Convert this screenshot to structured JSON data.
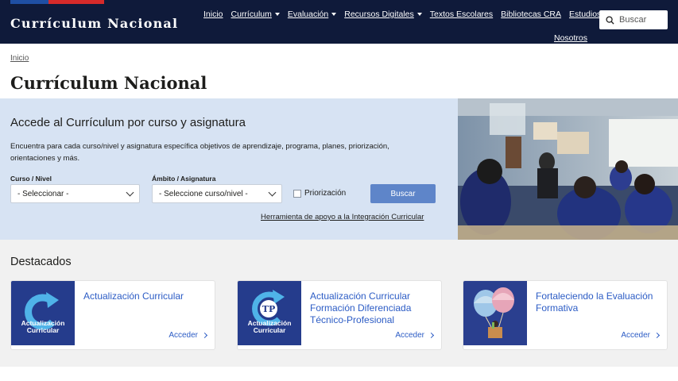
{
  "header": {
    "logo": "Currículum Nacional",
    "nav": [
      {
        "label": "Inicio",
        "dropdown": false
      },
      {
        "label": "Currículum",
        "dropdown": true
      },
      {
        "label": "Evaluación",
        "dropdown": true
      },
      {
        "label": "Recursos Digitales",
        "dropdown": true
      },
      {
        "label": "Textos Escolares",
        "dropdown": false
      },
      {
        "label": "Bibliotecas CRA",
        "dropdown": false
      },
      {
        "label": "Estudios",
        "dropdown": false
      }
    ],
    "nav_second_row": "Nosotros",
    "search_placeholder": "Buscar"
  },
  "breadcrumb": "Inicio",
  "page_title": "Currículum Nacional",
  "hero": {
    "heading": "Accede al Currículum por curso y asignatura",
    "description": "Encuentra para cada curso/nivel y asignatura específica objetivos de aprendizaje, programa, planes, priorización, orientaciones y más.",
    "curso_label": "Curso / Nivel",
    "curso_value": "- Seleccionar -",
    "ambito_label": "Ámbito / Asignatura",
    "ambito_value": "- Seleccione curso/nivel -",
    "priorizacion_label": "Priorización",
    "buscar_label": "Buscar",
    "tool_link": "Herramienta de apoyo a la Integración Curricular"
  },
  "destacados": {
    "heading": "Destacados",
    "cards": [
      {
        "title": "Actualización Curricular",
        "thumb_text": "Actualización Curricular",
        "action": "Acceder"
      },
      {
        "title": "Actualización Curricular Formación Diferenciada Técnico-Profesional",
        "thumb_text": "Actualización Curricular",
        "action": "Acceder"
      },
      {
        "title": "Fortaleciendo la Evaluación Formativa",
        "thumb_text": "",
        "action": "Acceder"
      }
    ]
  },
  "colors": {
    "header_bg": "#0f1a3a",
    "hero_bg": "#d7e3f3",
    "accent": "#2c5cc5",
    "button": "#5e85c9"
  }
}
